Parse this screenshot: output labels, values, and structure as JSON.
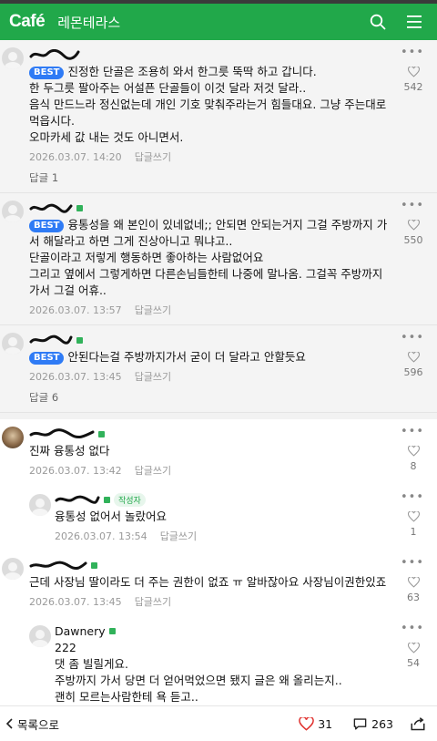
{
  "header": {
    "logo": "Café",
    "cafe_name": "레몬테라스",
    "search_icon": "search-icon",
    "menu_icon": "hamburger-icon",
    "color": "#21a84a"
  },
  "comments": [
    {
      "best": true,
      "best_label": "BEST",
      "text": "진정한 단골은 조용히 와서 한그릇 뚝딱 하고 갑니다.\n한 두그릇 팔아주는 어설픈 단골들이 이것 달라 저것 달라..\n음식 만드느라 정신없는데 개인 기호 맞춰주라는거 힘들대요. 그냥 주는대로 먹읍시다.\n오마카세 값 내는 것도 아니면서.",
      "date": "2026.03.07. 14:20",
      "reply_label": "답글쓰기",
      "reply_count": "답글 1",
      "likes": "542"
    },
    {
      "best": true,
      "best_label": "BEST",
      "text": "융통성을 왜 본인이 있네없네;; 안되면 안되는거지 그걸 주방까지 가서 해달라고 하면 그게 진상아니고 뭐냐고..\n단골이라고 저렇게 행동하면 좋아하는 사람없어요\n그리고 옆에서 그렇게하면 다른손님들한테 나중에 말나옴. 그걸꼭 주방까지가서 그걸 어휴..",
      "date": "2026.03.07. 13:57",
      "reply_label": "답글쓰기",
      "likes": "550"
    },
    {
      "best": true,
      "best_label": "BEST",
      "text": "안된다는걸 주방까지가서 굳이 더 달라고 안할듯요",
      "date": "2026.03.07. 13:45",
      "reply_label": "답글쓰기",
      "reply_count": "답글 6",
      "likes": "596"
    },
    {
      "text": "진짜 융통성 없다",
      "date": "2026.03.07. 13:42",
      "reply_label": "답글쓰기",
      "likes": "8"
    },
    {
      "reply": true,
      "writer_tag": "작성자",
      "text": "융통성 없어서 놀랐어요",
      "date": "2026.03.07. 13:54",
      "reply_label": "답글쓰기",
      "likes": "1"
    },
    {
      "text": "근데 사장님 딸이라도 더 주는 권한이 없죠 ㅠ 알바잖아요 사장님이권한있죠",
      "date": "2026.03.07. 13:45",
      "reply_label": "답글쓰기",
      "likes": "63"
    },
    {
      "reply": true,
      "nick": "Dawnery",
      "text": "222\n댓 좀 빌릴게요.\n주방까지 가서 당면 더 얻어먹었으면 됐지 글은 왜 올리는지..\n괜히 모르는사람한테 욕 듣고..\n같이 딸 욕해달라고 올린거에요?\n그냥 그러고 넘겨요. 별것도 아닌걸로 편들어달라 글 쓰지말고요",
      "likes": "54"
    }
  ],
  "bottom": {
    "list_label": "목록으로",
    "likes": "31",
    "comments": "263",
    "heart_color": "#e0322f"
  }
}
